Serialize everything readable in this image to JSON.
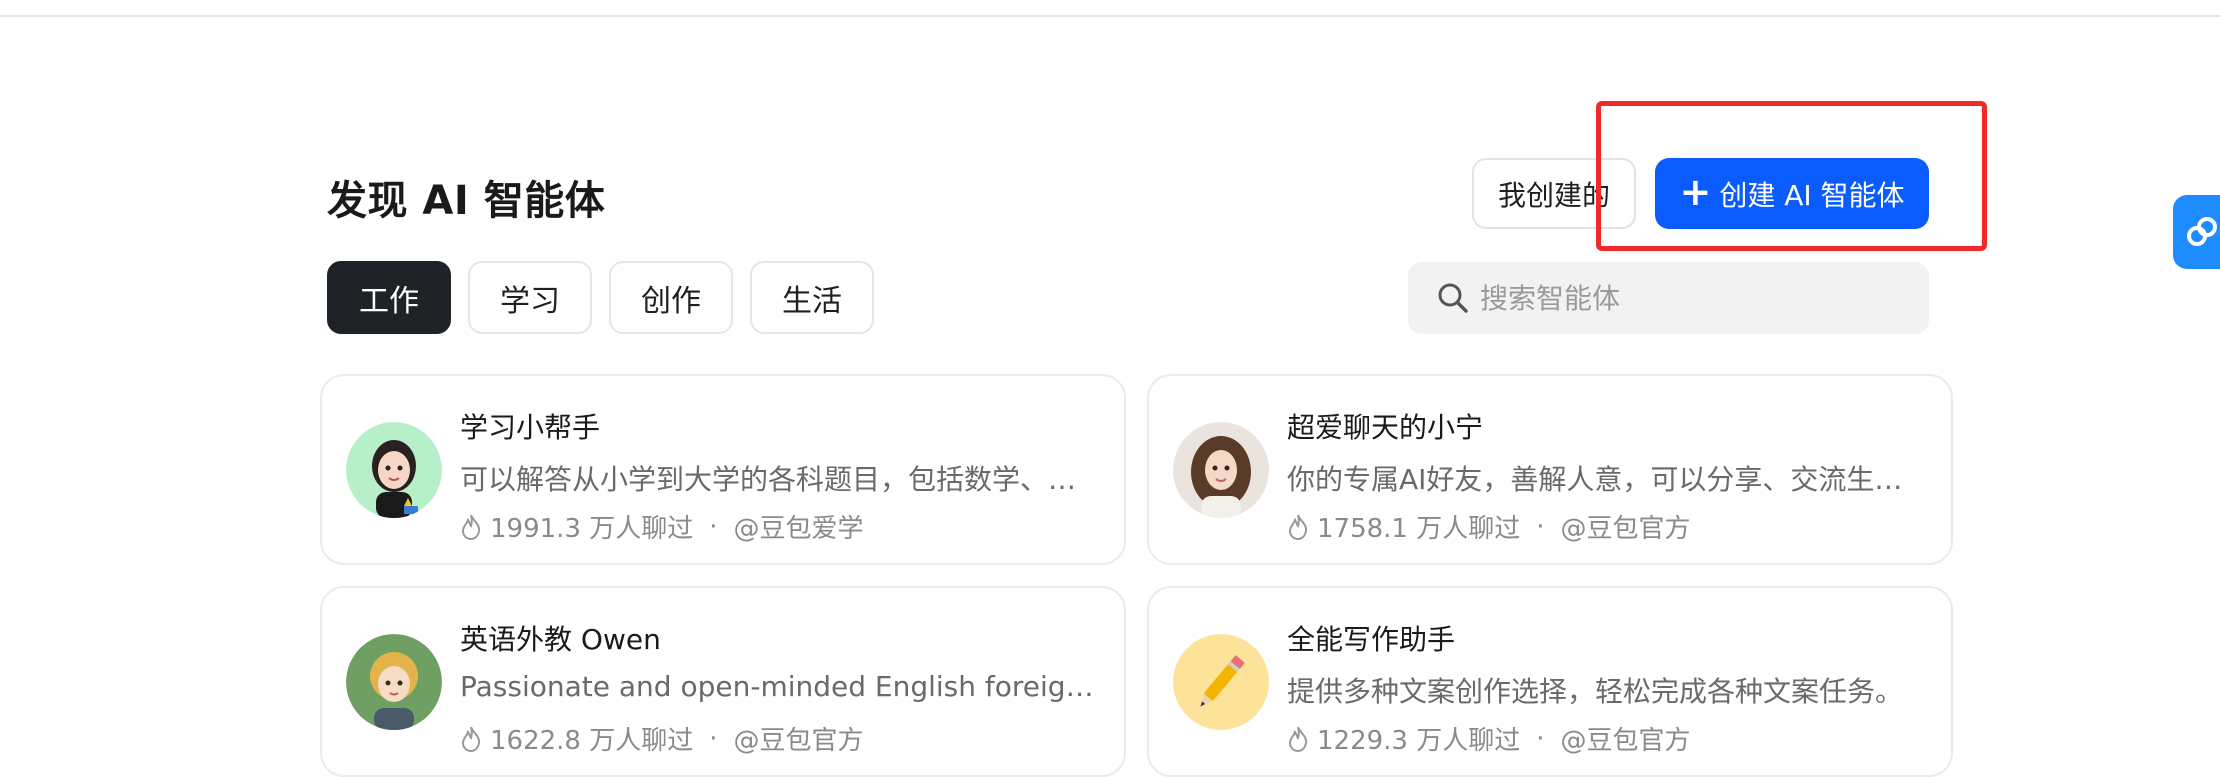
{
  "page": {
    "title": "发现 AI 智能体"
  },
  "actions": {
    "mine_label": "我创建的",
    "create_label": "创建 AI 智能体"
  },
  "tabs": [
    {
      "label": "工作",
      "active": true
    },
    {
      "label": "学习",
      "active": false
    },
    {
      "label": "创作",
      "active": false
    },
    {
      "label": "生活",
      "active": false
    }
  ],
  "search": {
    "placeholder": "搜索智能体",
    "value": ""
  },
  "agents": [
    {
      "name": "学习小帮手",
      "desc": "可以解答从小学到大学的各科题目，包括数学、语文、英语、物理、化学等",
      "chats": "1991.3 万人聊过",
      "author": "@豆包爱学"
    },
    {
      "name": "超爱聊天的小宁",
      "desc": "你的专属AI好友，善解人意，可以分享、交流生活中的点滴",
      "chats": "1758.1 万人聊过",
      "author": "@豆包官方"
    },
    {
      "name": "英语外教 Owen",
      "desc": "Passionate and open-minded English foreign teacher",
      "chats": "1622.8 万人聊过",
      "author": "@豆包官方"
    },
    {
      "name": "全能写作助手",
      "desc": "提供多种文案创作选择，轻松完成各种文案任务。",
      "chats": "1229.3 万人聊过",
      "author": "@豆包官方"
    }
  ],
  "colors": {
    "accent": "#0a5cff",
    "highlight": "#ee2a2a",
    "tab_active": "#1f2328"
  }
}
